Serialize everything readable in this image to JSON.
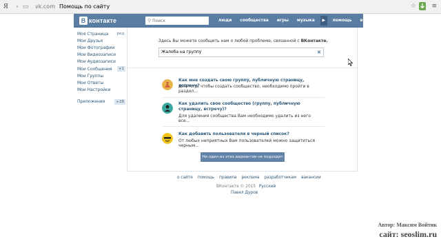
{
  "browser": {
    "logo": "Я",
    "domain": "vk.com",
    "tab_title": "Помощь по сайту"
  },
  "header": {
    "logo_letter": "В",
    "logo_text": "контакте",
    "search_placeholder": "Поиск",
    "nav": [
      "люди",
      "сообщества",
      "игры",
      "музыка",
      "помощь",
      "выйти"
    ],
    "play_glyph": "▶"
  },
  "sidebar": {
    "items": [
      {
        "label": "Моя Страница",
        "suffix": "ред."
      },
      {
        "label": "Мои Друзья"
      },
      {
        "label": "Мои Фотографии"
      },
      {
        "label": "Мои Видеозаписи"
      },
      {
        "label": "Мои Аудиозаписи"
      },
      {
        "label": "Мои Сообщения",
        "badge": "+1"
      },
      {
        "label": "Мои Группы"
      },
      {
        "label": "Мои Ответы"
      },
      {
        "label": "Мои Настройки"
      }
    ],
    "apps": {
      "label": "Приложения",
      "badge": "+28"
    }
  },
  "help": {
    "intro_prefix": "Здесь Вы можете сообщить нам о любой проблеме, связанной с ",
    "intro_brand": "ВКонтакте.",
    "query_value": "Жалоба на группу",
    "faqs": [
      {
        "title": "Как мне создать свою группу, публичную страницу, встречу?",
        "desc": "Для того, чтобы создать сообщество, необходимо пройти в раздел..."
      },
      {
        "title": "Как удалить свое сообщество (группу, публичную страницу, встречу)?",
        "desc": "Для удаления сообщества Вам необходимо удалить из него все..."
      },
      {
        "title": "Как добавить пользователя в черный список?",
        "desc": "От любых неприятных Вам пользователей можно защититься черным..."
      }
    ],
    "none_button": "Ни один из этих вариантов не подходит"
  },
  "footer": {
    "links": [
      "о сайте",
      "помощь",
      "правила",
      "реклама",
      "разработчикам",
      "вакансии"
    ],
    "copyright": "ВКонтакте © 2015",
    "language": "Русский",
    "author": "Павел Дуров"
  },
  "watermark": {
    "line1": "Автор: Максим Войтик",
    "line2": "сайт: seoslim.ru"
  },
  "colors": {
    "header_bg": "#597da3",
    "link": "#2b587a",
    "button": "#6383a8"
  }
}
